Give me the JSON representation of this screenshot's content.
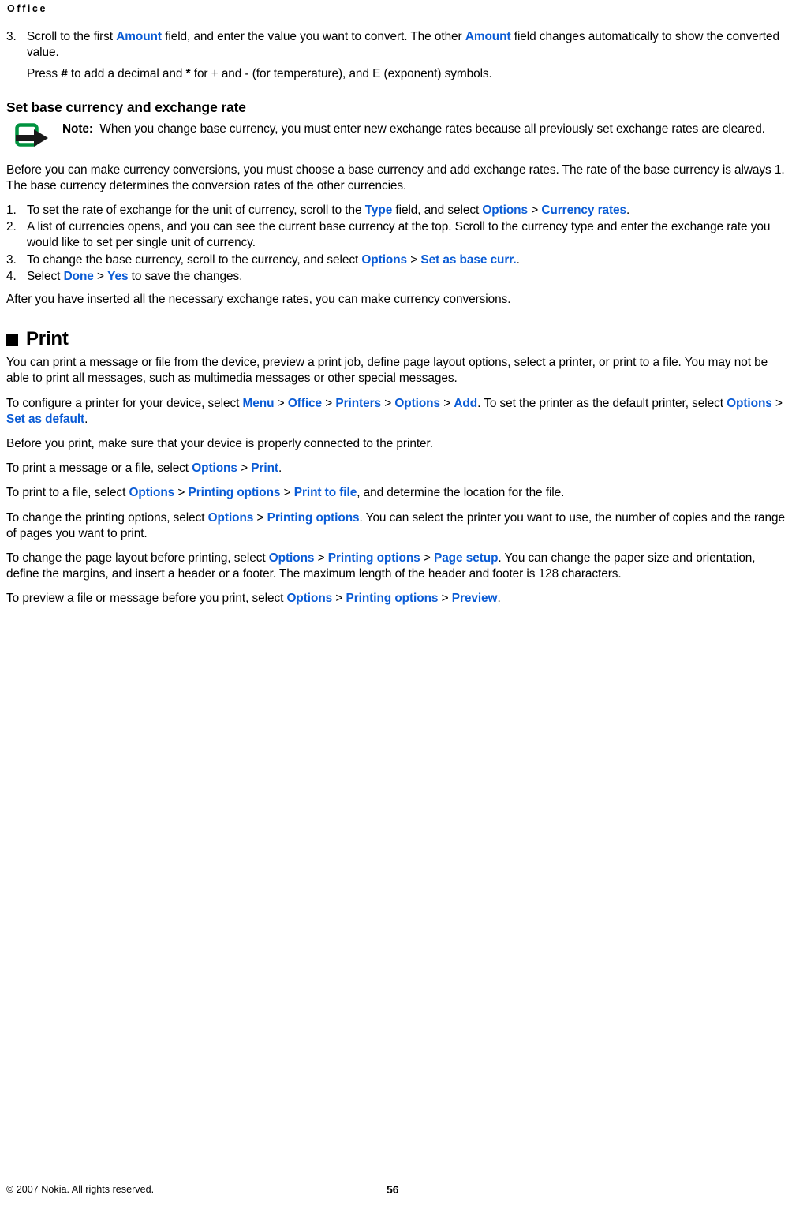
{
  "header": {
    "running_title": "Office"
  },
  "content": {
    "step3": {
      "num": "3.",
      "text_a": "Scroll to the first ",
      "ui_amount_1": "Amount",
      "text_b": " field, and enter the value you want to convert. The other ",
      "ui_amount_2": "Amount",
      "text_c": " field changes automatically to show the converted value.",
      "sub_a": "Press ",
      "sub_hash": "#",
      "sub_b": " to add a decimal and ",
      "sub_star": "*",
      "sub_c": " for + and - (for temperature), and E (exponent) symbols."
    },
    "heading_base_currency": "Set base currency and exchange rate",
    "note": {
      "label": "Note:",
      "text": "When you change base currency, you must enter new exchange rates because all previously set exchange rates are cleared."
    },
    "para_before_conversions": "Before you can make currency conversions, you must choose a base currency and add exchange rates. The rate of the base currency is always 1. The base currency determines the conversion rates of the other currencies.",
    "currency_steps": [
      {
        "num": "1.",
        "text_a": "To set the rate of exchange for the unit of currency, scroll to the ",
        "ui_1": "Type",
        "text_b": " field, and select ",
        "ui_2": "Options",
        "sep": ">",
        "ui_3": "Currency rates",
        "text_c": "."
      },
      {
        "num": "2.",
        "text_a": "A list of currencies opens, and you can see the current base currency at the top. Scroll to the currency type and enter the exchange rate you would like to set per single unit of currency.",
        "ui_1": "",
        "sep": "",
        "ui_2": "",
        "ui_3": "",
        "text_b": "",
        "text_c": ""
      },
      {
        "num": "3.",
        "text_a": "To change the base currency, scroll to the currency, and select ",
        "ui_2": "Options",
        "sep": ">",
        "ui_3": "Set as base curr.",
        "text_c": "."
      },
      {
        "num": "4.",
        "text_a": "Select ",
        "ui_2": "Done",
        "sep": ">",
        "ui_3": "Yes",
        "text_c": " to save the changes."
      }
    ],
    "para_after_rates": "After you have inserted all the necessary exchange rates, you can make currency conversions.",
    "heading_print": "Print",
    "print_intro": "You can print a message or file from the device, preview a print job, define page layout options, select a printer, or print to a file. You may not be able to print all messages, such as multimedia messages or other special messages.",
    "configure_printer": {
      "text_a": "To configure a printer for your device, select ",
      "ui_menu": "Menu",
      "sep1": ">",
      "ui_office": "Office",
      "sep2": ">",
      "ui_printers": "Printers",
      "sep3": ">",
      "ui_options": "Options",
      "sep4": ">",
      "ui_add": "Add",
      "text_b": ". To set the printer as the default printer, select ",
      "ui_options2": "Options",
      "sep5": ">",
      "ui_setdefault": "Set as default",
      "text_c": "."
    },
    "para_connected": "Before you print, make sure that your device is properly connected to the printer.",
    "print_message": {
      "text_a": "To print a message or a file, select ",
      "ui_options": "Options",
      "sep1": ">",
      "ui_print": "Print",
      "text_b": "."
    },
    "print_to_file": {
      "text_a": "To print to a file, select ",
      "ui_options": "Options",
      "sep1": ">",
      "ui_printing_options": "Printing options",
      "sep2": ">",
      "ui_print_to_file": "Print to file",
      "text_b": ", and determine the location for the file."
    },
    "change_printing_options": {
      "text_a": "To change the printing options, select ",
      "ui_options": "Options",
      "sep1": ">",
      "ui_printing_options": "Printing options",
      "text_b": ". You can select the printer you want to use, the number of copies and the range of pages you want to print."
    },
    "page_layout": {
      "text_a": "To change the page layout before printing, select ",
      "ui_options": "Options",
      "sep1": ">",
      "ui_printing_options": "Printing options",
      "sep2": ">",
      "ui_page_setup": "Page setup",
      "text_b": ". You can change the paper size and orientation, define the margins, and insert a header or a footer. The maximum length of the header and footer is 128 characters."
    },
    "preview": {
      "text_a": "To preview a file or message before you print, select ",
      "ui_options": "Options",
      "sep1": ">",
      "ui_printing_options": "Printing options",
      "sep2": ">",
      "ui_preview": "Preview",
      "text_b": "."
    }
  },
  "footer": {
    "copyright": "© 2007 Nokia. All rights reserved.",
    "page_number": "56"
  },
  "colors": {
    "ui_link": "#0b5cd5",
    "note_icon_green": "#00923f",
    "text": "#000000",
    "background": "#ffffff"
  }
}
